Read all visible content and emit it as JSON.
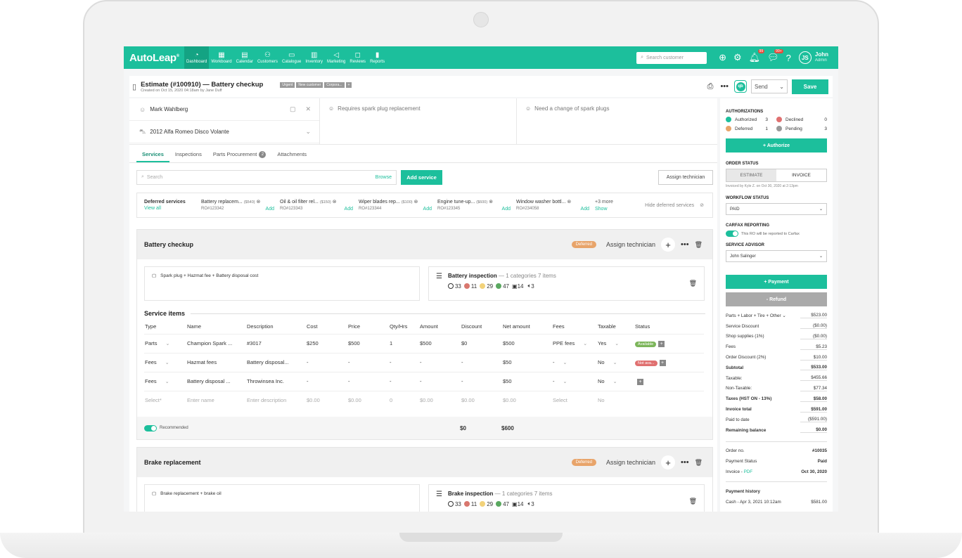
{
  "nav": {
    "logo": "AutoLeap",
    "items": [
      {
        "icon": "dashboard-icon",
        "glyph": "◔",
        "label": "Dashboard",
        "active": true
      },
      {
        "icon": "workboard-icon",
        "glyph": "▦",
        "label": "Workboard"
      },
      {
        "icon": "calendar-icon",
        "glyph": "▤",
        "label": "Calendar"
      },
      {
        "icon": "customers-icon",
        "glyph": "⚇",
        "label": "Customers"
      },
      {
        "icon": "catalogue-icon",
        "glyph": "▭",
        "label": "Catalogue"
      },
      {
        "icon": "inventory-icon",
        "glyph": "▥",
        "label": "Inventory"
      },
      {
        "icon": "marketing-icon",
        "glyph": "◁",
        "label": "Marketing"
      },
      {
        "icon": "reviews-icon",
        "glyph": "◻",
        "label": "Reviews"
      },
      {
        "icon": "reports-icon",
        "glyph": "▮",
        "label": "Reports"
      }
    ],
    "search_placeholder": "Search customer",
    "notif_count": "99",
    "msg_count": "99+",
    "user_initials": "JS",
    "user_name": "John",
    "user_role": "Admin"
  },
  "header": {
    "title": "Estimate (#100910) — Battery checkup",
    "subtitle": "Created on Oct 15, 2020 04:18am by Jane Duff",
    "tags": [
      "Urgent",
      "New customer",
      "Corpora...",
      "+"
    ],
    "qb_label": "qb",
    "send_label": "Send",
    "save_label": "Save"
  },
  "info": {
    "customer": "Mark Wahlberg",
    "vehicle": "2012 Alfa Romeo Disco Volante",
    "concern1": "Requires spark plug replacement",
    "concern2": "Need a change of spark plugs"
  },
  "tabs": [
    {
      "label": "Services",
      "active": true
    },
    {
      "label": "Inspections"
    },
    {
      "label": "Parts Procurement",
      "count": "2"
    },
    {
      "label": "Attachments"
    }
  ],
  "search": {
    "placeholder": "Search",
    "browse": "Browse",
    "add_service": "Add service",
    "assign_technician": "Assign technician"
  },
  "deferred": {
    "title": "Deferred services",
    "view_all": "View all",
    "items": [
      {
        "name": "Battery replacem...",
        "amount": "($540)",
        "ro": "RO#123342",
        "add": "Add"
      },
      {
        "name": "Oil & oil filter rel...",
        "amount": "($150)",
        "ro": "RO#123343",
        "add": "Add"
      },
      {
        "name": "Wiper blades rep...",
        "amount": "($100)",
        "ro": "RO#123344",
        "add": "Add"
      },
      {
        "name": "Engine tune-up...",
        "amount": "($600)",
        "ro": "RO#123345",
        "add": "Add"
      },
      {
        "name": "Window washer bottl...",
        "amount": "",
        "ro": "RO#234058",
        "add": "Add"
      }
    ],
    "more": "+3 more",
    "show": "Show",
    "hide": "Hide deferred services"
  },
  "sections": [
    {
      "title": "Battery checkup",
      "status": "Deferred",
      "assign": "Assign technician",
      "note": "Spark plug + Hazmat fee + Battery disposal cost",
      "inspection_title": "Battery inspection",
      "inspection_sub": "— 1 categories  7 items",
      "stats": {
        "none": "33",
        "red": "11",
        "yellow": "29",
        "green": "47",
        "photos": "14",
        "audio": "3"
      },
      "items_title": "Service items",
      "columns": [
        "Type",
        "Name",
        "Description",
        "Cost",
        "Price",
        "Qty/Hrs",
        "Amount",
        "Discount",
        "Net amount",
        "Fees",
        "Taxable",
        "Status"
      ],
      "rows": [
        {
          "type": "Parts",
          "name": "Champion Spark ...",
          "desc": "#3017",
          "cost": "$250",
          "price": "$500",
          "qty": "1",
          "amount": "$500",
          "discount": "$0",
          "net": "$500",
          "fees": "PPE fees",
          "taxable": "Yes",
          "status": "Available"
        },
        {
          "type": "Fees",
          "name": "Hazmat fees",
          "desc": "Battery disposal...",
          "cost": "-",
          "price": "-",
          "qty": "-",
          "amount": "-",
          "discount": "-",
          "net": "$50",
          "fees": "-",
          "taxable": "No",
          "status": "Not ava..."
        },
        {
          "type": "Fees",
          "name": "Battery disposal ...",
          "desc": "Throwinsea Inc.",
          "cost": "-",
          "price": "-",
          "qty": "-",
          "amount": "-",
          "discount": "-",
          "net": "$50",
          "fees": "-",
          "taxable": "No",
          "status": ""
        }
      ],
      "placeholder_row": {
        "type": "Select*",
        "name": "Enter name",
        "desc": "Enter description",
        "cost": "$0.00",
        "price": "$0.00",
        "qty": "0",
        "amount": "$0.00",
        "discount": "$0.00",
        "net": "$0.00",
        "fees": "Select",
        "taxable": "No"
      },
      "recommended": "Recommended",
      "total_discount": "$0",
      "total_net": "$600"
    },
    {
      "title": "Brake replacement",
      "status": "Deferred",
      "assign": "Assign technician",
      "note": "Brake replacement + brake oil",
      "inspection_title": "Brake inspection",
      "inspection_sub": "— 1 categories  7 items",
      "stats": {
        "none": "33",
        "red": "11",
        "yellow": "29",
        "green": "47",
        "photos": "14",
        "audio": "3"
      }
    }
  ],
  "side": {
    "auth_title": "AUTHORIZATIONS",
    "auth": [
      {
        "label": "Authorized",
        "value": "3",
        "color": "#1cbf9c"
      },
      {
        "label": "Declined",
        "value": "0",
        "color": "#e07070"
      },
      {
        "label": "Deferred",
        "value": "1",
        "color": "#e8a46a"
      },
      {
        "label": "Pending",
        "value": "3",
        "color": "#999999"
      }
    ],
    "authorize": "+ Authorize",
    "order_status_title": "ORDER STATUS",
    "estimate": "ESTIMATE",
    "invoice": "INVOICE",
    "invoiced_by": "Invoiced by Kyle Z. on Oct 30, 2020 at 2:13pm",
    "workflow_title": "WORKFLOW STATUS",
    "workflow_value": "PAID",
    "carfax_title": "CARFAX REPORTING",
    "carfax_note": "This RO will be reported to Carfax",
    "advisor_title": "SERVICE ADVISOR",
    "advisor_value": "John Salinger",
    "payment": "+ Payment",
    "refund": "- Refund",
    "summary": [
      {
        "label": "Parts + Labor + Tire + Other ⌄",
        "value": "$523.00"
      },
      {
        "label": "Service Discount",
        "value": "($0.00)"
      },
      {
        "label": "Shop supplies (1%)",
        "value": "($0.00)"
      },
      {
        "label": "Fees",
        "value": "$5.23"
      },
      {
        "label": "Order Discount (2%)",
        "value": "$10.00"
      },
      {
        "label": "Subtotal",
        "value": "$533.00",
        "bold": true
      },
      {
        "label": "Taxable:",
        "value": "$455.66"
      },
      {
        "label": "Non-Taxable:",
        "value": "$77.34"
      },
      {
        "label": "Taxes (HST ON - 13%)",
        "value": "$58.00",
        "bold": true
      },
      {
        "label": "Invoice total",
        "value": "$591.00",
        "bold": true
      },
      {
        "label": "Paid to date",
        "value": "($591.00)"
      },
      {
        "label": "Remaining balance",
        "value": "$0.00",
        "bold": true
      }
    ],
    "order_no_label": "Order no.",
    "order_no": "#10035",
    "payment_status_label": "Payment Status",
    "payment_status": "Paid",
    "invoice_label": "Invoice - ",
    "pdf": "PDF",
    "invoice_date": "Oct 30, 2020",
    "history_title": "Payment history",
    "history_item": "Cash - Apr 3, 2021 10:12am",
    "history_amount": "$581.00"
  }
}
